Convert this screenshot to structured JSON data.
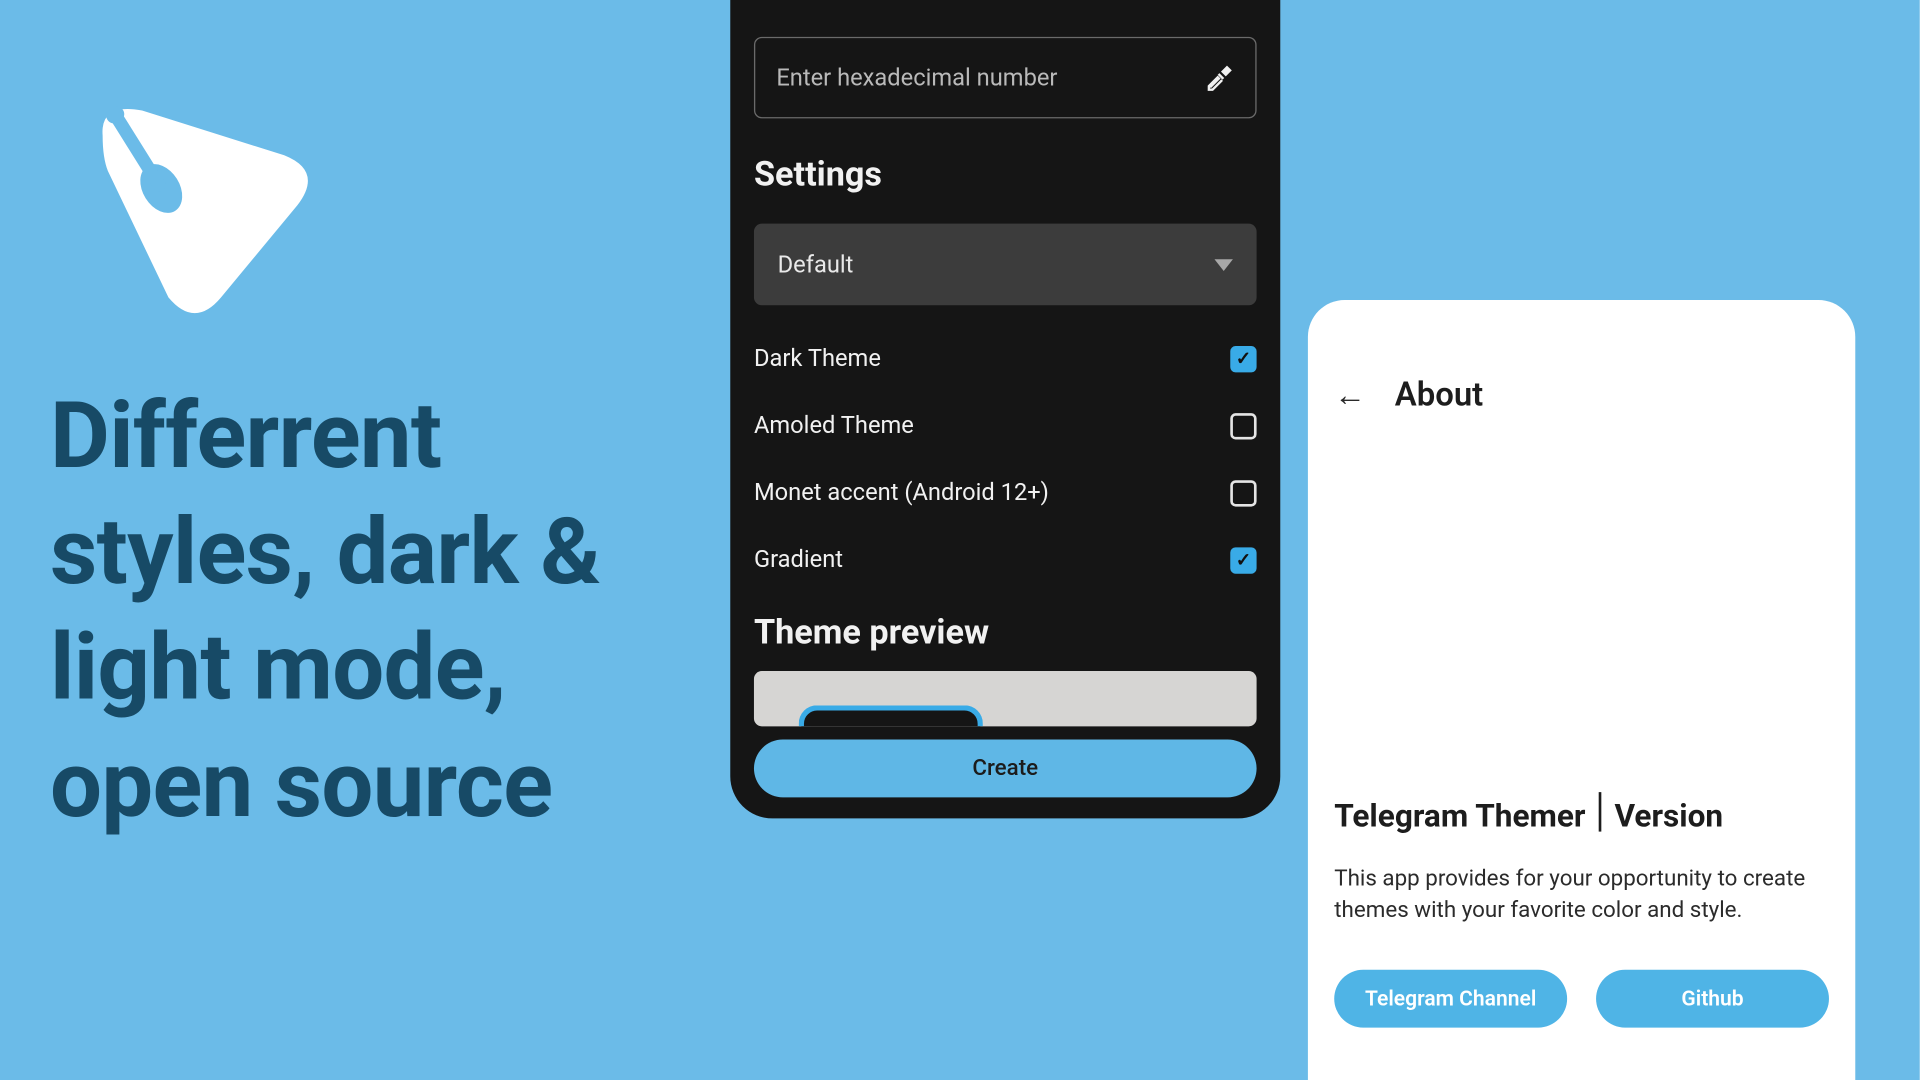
{
  "promo": {
    "tagline": "Differrent styles, dark & light mode, open source"
  },
  "dark": {
    "hex_placeholder": "Enter hexadecimal number",
    "settings_title": "Settings",
    "dropdown_value": "Default",
    "options": {
      "dark": "Dark Theme",
      "amoled": "Amoled Theme",
      "monet": "Monet accent (Android 12+)",
      "gradient": "Gradient"
    },
    "theme_preview_title": "Theme preview",
    "create_label": "Create"
  },
  "about": {
    "title": "About",
    "app_name": "Telegram Themer",
    "version_label": "Version",
    "description": "This app provides for your opportunity to create themes with your favorite color and style.",
    "btn_channel": "Telegram Channel",
    "btn_github": "Github"
  }
}
